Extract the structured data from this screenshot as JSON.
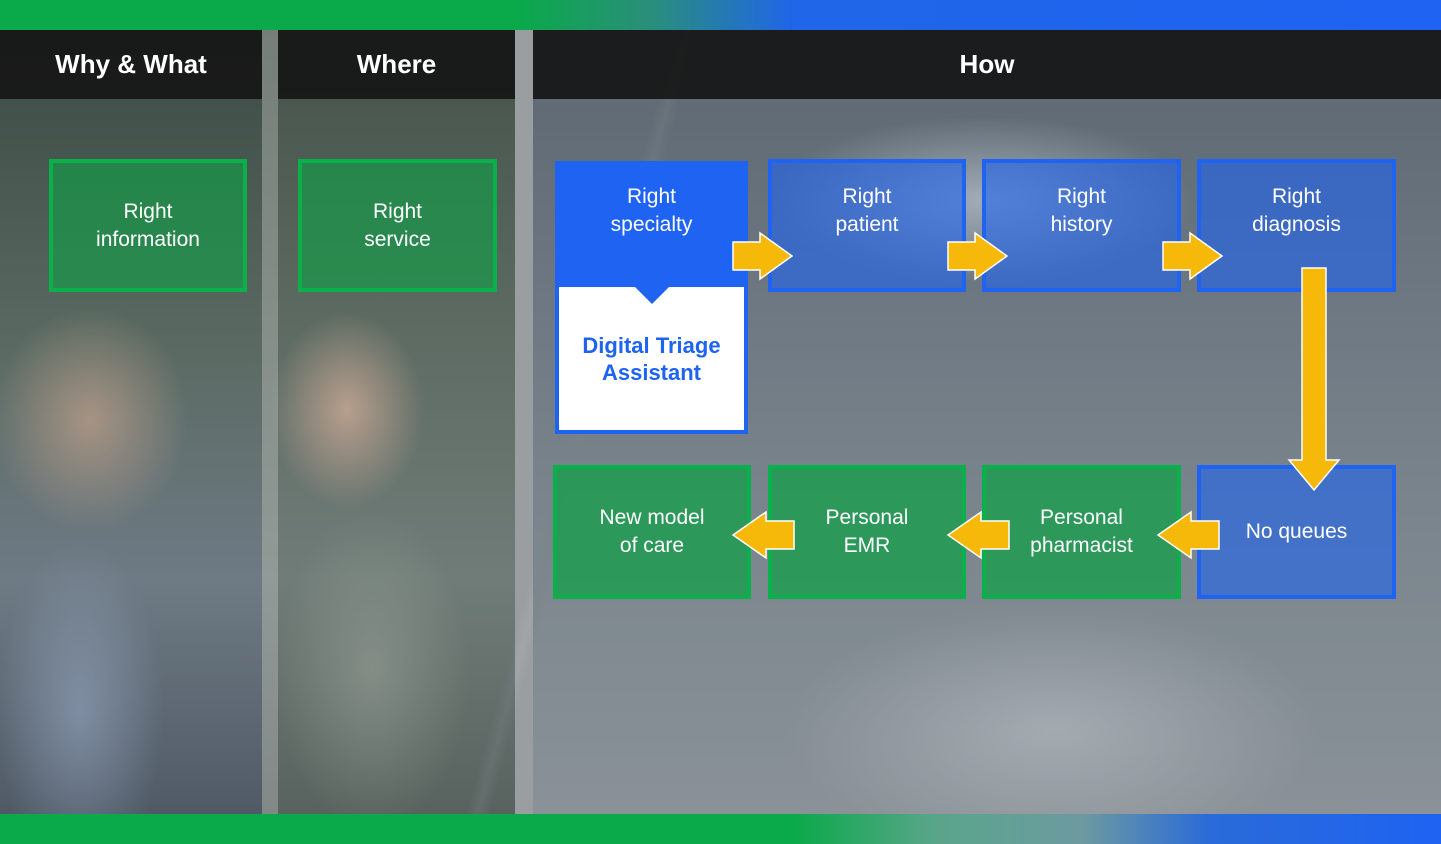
{
  "columns": {
    "why_what": "Why & What",
    "where": "Where",
    "how": "How"
  },
  "left_boxes": {
    "information": "Right\ninformation",
    "service": "Right\nservice"
  },
  "flow_top": [
    "Right\nspecialty",
    "Right\npatient",
    "Right\nhistory",
    "Right\ndiagnosis"
  ],
  "callout": "Digital Triage\nAssistant",
  "flow_bottom": [
    "New model\nof care",
    "Personal\nEMR",
    "Personal\npharmacist",
    "No queues"
  ],
  "colors": {
    "green": "#0ab04a",
    "blue": "#1e63f2",
    "arrow": "#f6b90a",
    "header_bg": "#161616"
  },
  "icons": [
    "arrow-right-icon",
    "arrow-down-icon",
    "arrow-left-icon"
  ]
}
